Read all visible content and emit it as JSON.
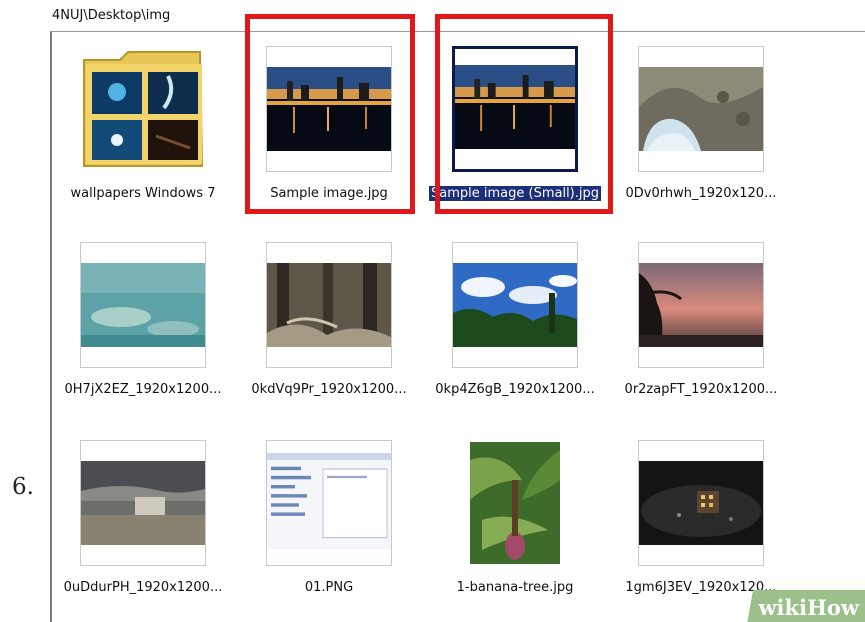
{
  "step": "6.",
  "address_path": "4NUJ\\Desktop\\img",
  "files": [
    {
      "name": "wallpapers Windows 7",
      "type": "folder"
    },
    {
      "name": "Sample image.jpg",
      "type": "image"
    },
    {
      "name": "Sample image (Small).jpg",
      "type": "image",
      "selected": true
    },
    {
      "name": "0Dv0rhwh_1920x120...",
      "type": "image"
    },
    {
      "name": "0H7jX2EZ_1920x1200...",
      "type": "image"
    },
    {
      "name": "0kdVq9Pr_1920x1200...",
      "type": "image"
    },
    {
      "name": "0kp4Z6gB_1920x1200...",
      "type": "image"
    },
    {
      "name": "0r2zapFT_1920x1200...",
      "type": "image"
    },
    {
      "name": "0uDdurPH_1920x1200...",
      "type": "image"
    },
    {
      "name": "01.PNG",
      "type": "image"
    },
    {
      "name": "1-banana-tree.jpg",
      "type": "image"
    },
    {
      "name": "1gm6J3EV_1920x120...",
      "type": "image"
    }
  ],
  "highlight_color": "#e01818",
  "selection_color": "#1b2f7a",
  "watermark": {
    "text": "wikiHow"
  }
}
